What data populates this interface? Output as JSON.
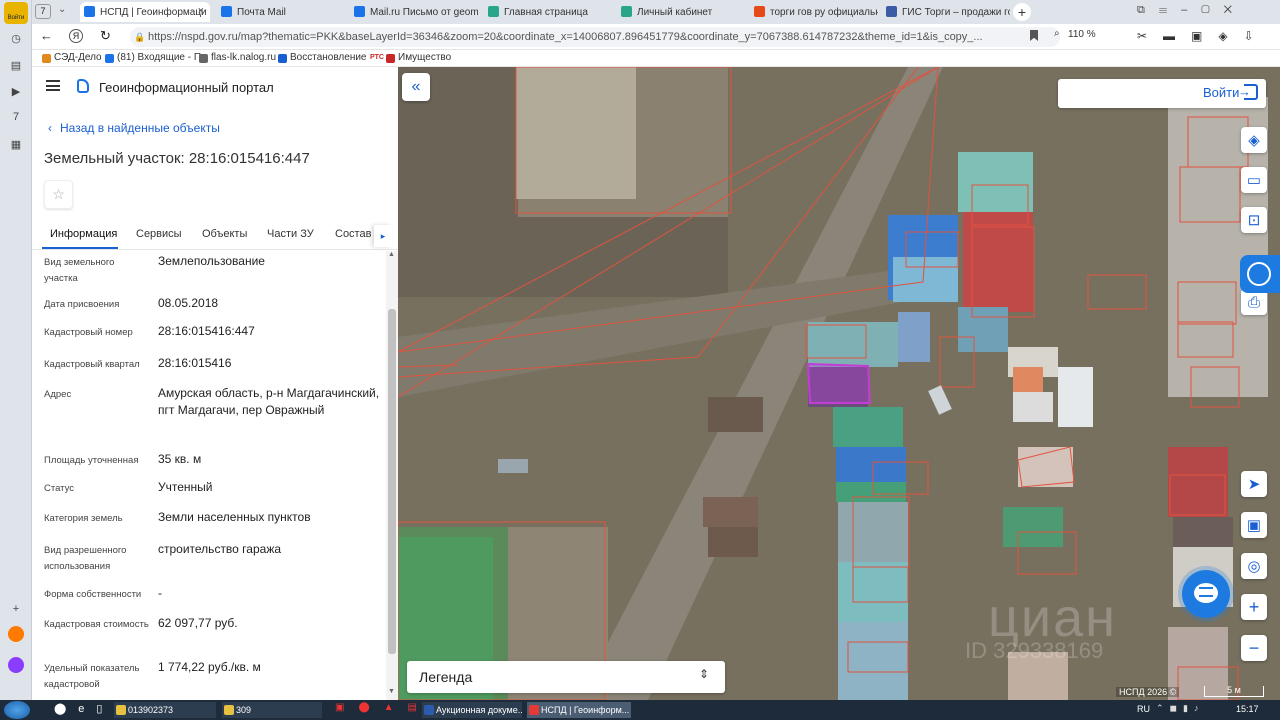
{
  "browser": {
    "rail_badge": "Войти",
    "tab_counter": "7",
    "tabs": [
      {
        "label": "НСПД | Геоинформаци",
        "color": "#1a73e8"
      },
      {
        "label": "Почта Mail",
        "color": "#1a73e8"
      },
      {
        "label": "Mail.ru Письмо от geomir.",
        "color": "#1a73e8"
      },
      {
        "label": "Главная страница",
        "color": "#2aa58a"
      },
      {
        "label": "Личный кабинет",
        "color": "#2aa58a"
      },
      {
        "label": "торги гов ру официальны",
        "color": "#e64a19"
      },
      {
        "label": "ГИС Торги – продажи гос",
        "color": "#3b5ba5"
      }
    ],
    "url": "https://nspd.gov.ru/map?thematic=PKK&baseLayerId=36346&zoom=20&coordinate_x=14006807.896451779&coordinate_y=7067388.614787232&theme_id=1&is_copy_...",
    "zoom": "110 %",
    "bookmarks": [
      {
        "label": "СЭД-Дело",
        "color": "#e08a1e"
      },
      {
        "label": "(81) Входящие - П",
        "color": "#1a73e8"
      },
      {
        "label": "flas-lk.nalog.ru",
        "color": "#666"
      },
      {
        "label": "Восстановление",
        "color": "#1a5fd1"
      },
      {
        "label": "Имущество",
        "color": "#c62828"
      }
    ],
    "bookmark_rts": "РТС"
  },
  "panel": {
    "portal_title": "Геоинформационный портал",
    "back_link": "Назад в найденные объекты",
    "object_title": "Земельный участок: 28:16:015416:447",
    "tabs": [
      "Информация",
      "Сервисы",
      "Объекты",
      "Части ЗУ",
      "Состав"
    ],
    "fields": [
      {
        "label": "Вид земельного участка",
        "value": "Землепользование"
      },
      {
        "label": "Дата присвоения",
        "value": "08.05.2018"
      },
      {
        "label": "Кадастровый номер",
        "value": "28:16:015416:447"
      },
      {
        "label": "Кадастровый квартал",
        "value": "28:16:015416"
      },
      {
        "label": "Адрес",
        "value": "Амурская область, р-н Магдагачинский, пгт Магдагачи, пер Овражный"
      },
      {
        "label": "Площадь уточненная",
        "value": "35 кв. м"
      },
      {
        "label": "Статус",
        "value": "Учтенный"
      },
      {
        "label": "Категория земель",
        "value": "Земли населенных пунктов"
      },
      {
        "label": "Вид разрешенного использования",
        "value": "строительство гаража"
      },
      {
        "label": "Форма собственности",
        "value": "-"
      },
      {
        "label": "Кадастровая стоимость",
        "value": "62 097,77 руб."
      },
      {
        "label": "Удельный показатель кадастровой",
        "value": "1 774,22 руб./кв. м"
      }
    ]
  },
  "map": {
    "login_label": "Войти",
    "legend_label": "Легенда",
    "copyright": "НСПД 2026 ©",
    "scale": "5 м",
    "watermark": "циан",
    "watermark_id": "ID 329338169"
  },
  "taskbar": {
    "items": [
      {
        "label": "013902373",
        "color": "#e6c040"
      },
      {
        "label": "309",
        "color": "#e6c040"
      },
      {
        "label": "Аукционная докуме...",
        "color": "#2b5cab"
      },
      {
        "label": "НСПД | Геоинформ...",
        "color": "#e53935"
      }
    ],
    "lang": "RU",
    "time": "15:17"
  }
}
